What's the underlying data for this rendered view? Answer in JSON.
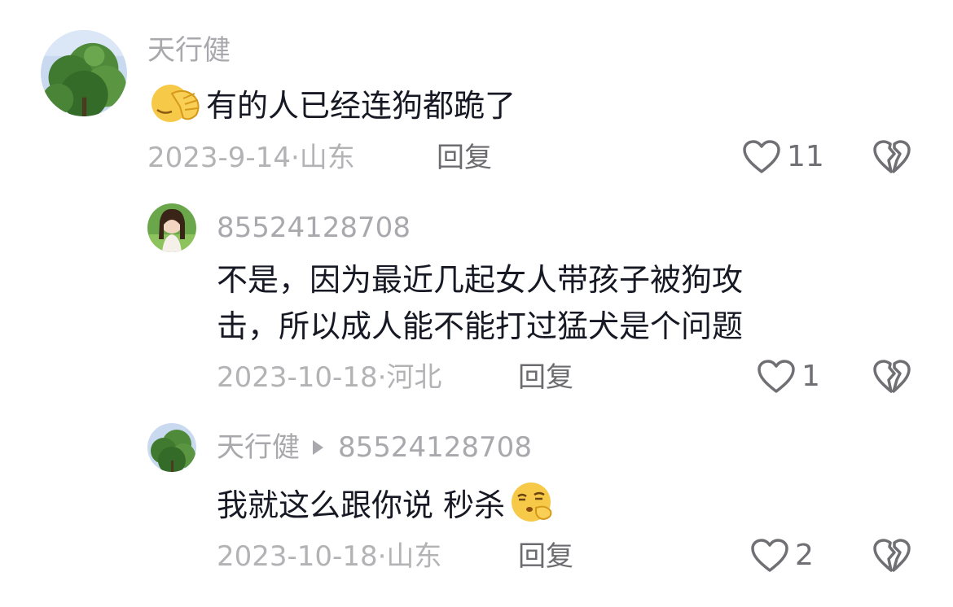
{
  "comments": [
    {
      "username": "天行健",
      "emoji": "facepalm-emoji",
      "text": "有的人已经连狗都跪了",
      "date": "2023-9-14",
      "location": "山东",
      "reply_label": "回复",
      "likes": "11"
    },
    {
      "username": "85524128708",
      "text_line1": "不是，因为最近几起女人带孩子被狗攻",
      "text_line2": "击，所以成人能不能打过猛犬是个问题",
      "date": "2023-10-18",
      "location": "河北",
      "reply_label": "回复",
      "likes": "1"
    },
    {
      "username": "天行健",
      "reply_to": "85524128708",
      "text": "我就这么跟你说 秒杀",
      "emoji": "thinking-squint-emoji",
      "date": "2023-10-18",
      "location": "山东",
      "reply_label": "回复",
      "likes": "2"
    }
  ],
  "meta_separator": "·",
  "icons": {
    "like": "heart-outline-icon",
    "dislike": "broken-heart-icon"
  },
  "colors": {
    "text_primary": "#161823",
    "text_secondary": "#a9a9ad",
    "icon": "#6f6f74"
  }
}
